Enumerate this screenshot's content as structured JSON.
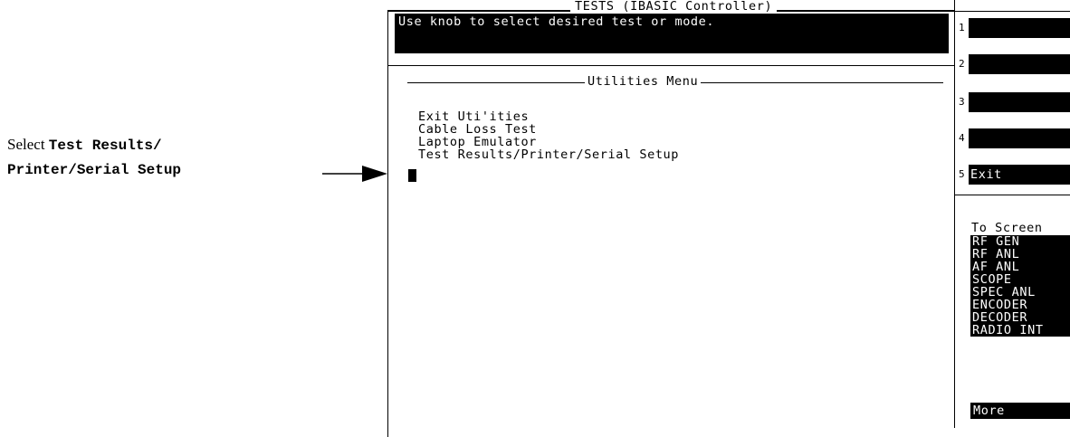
{
  "callout": {
    "prefix": "Select ",
    "line1_bold": "Test Results/",
    "line2_bold": "Printer/Serial Setup"
  },
  "screen": {
    "title": "TESTS (IBASIC Controller)",
    "message": "Use knob to select desired test or mode."
  },
  "menu": {
    "heading": "Utilities Menu",
    "items": [
      "Exit Uti'ities",
      "Cable Loss Test",
      "Laptop Emulator",
      "Test Results/Printer/Serial Setup"
    ]
  },
  "softkeys": [
    {
      "num": "1",
      "label": ""
    },
    {
      "num": "2",
      "label": ""
    },
    {
      "num": "3",
      "label": ""
    },
    {
      "num": "4",
      "label": ""
    },
    {
      "num": "5",
      "label": "Exit"
    }
  ],
  "to_screen": {
    "label": "To Screen",
    "items": [
      "RF GEN",
      "RF ANL",
      "AF ANL",
      "SCOPE",
      "SPEC ANL",
      "ENCODER",
      "DECODER",
      "RADIO INT"
    ],
    "more": "More"
  }
}
